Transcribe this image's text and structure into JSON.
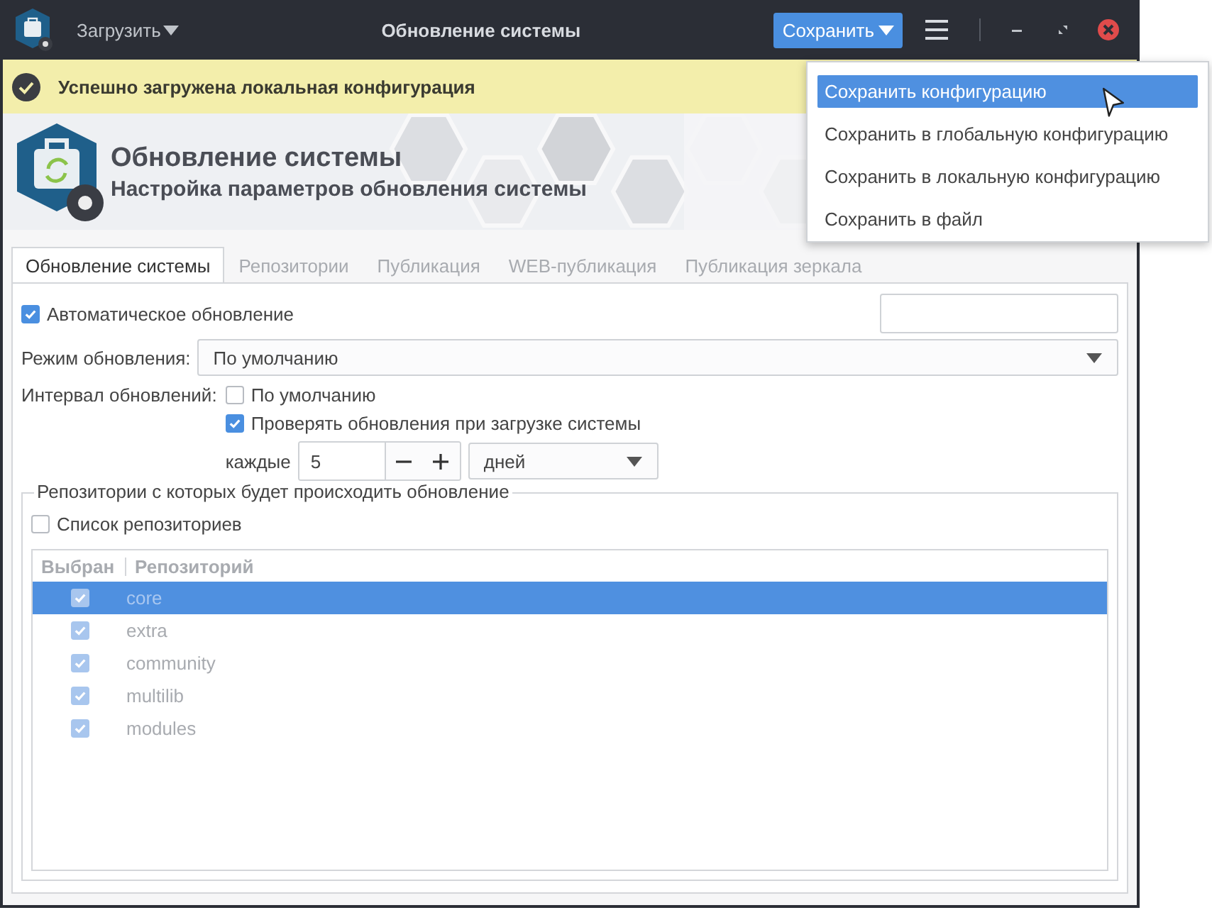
{
  "window": {
    "title": "Обновление системы"
  },
  "titlebar": {
    "load_button": "Загрузить",
    "save_button": "Сохранить"
  },
  "save_menu": {
    "items": [
      {
        "label": "Сохранить конфигурацию",
        "selected": true
      },
      {
        "label": "Сохранить в глобальную конфигурацию",
        "selected": false
      },
      {
        "label": "Сохранить в локальную конфигурацию",
        "selected": false
      },
      {
        "label": "Сохранить в файл",
        "selected": false
      }
    ]
  },
  "notification": {
    "text": "Успешно загружена локальная конфигурация"
  },
  "header": {
    "title": "Обновление системы",
    "subtitle": "Настройка параметров обновления системы"
  },
  "tabs": [
    {
      "label": "Обновление системы",
      "selected": true
    },
    {
      "label": "Репозитории",
      "selected": false
    },
    {
      "label": "Публикация",
      "selected": false
    },
    {
      "label": "WEB-публикация",
      "selected": false
    },
    {
      "label": "Публикация зеркала",
      "selected": false
    }
  ],
  "auto_update": {
    "label": "Автоматическое обновление",
    "checked": true
  },
  "update_mode": {
    "label": "Режим обновления:",
    "value": "По умолчанию"
  },
  "interval": {
    "label": "Интервал обновлений:",
    "options": [
      {
        "label": "По умолчанию",
        "checked": false
      },
      {
        "label": "Проверять обновления при загрузке системы",
        "checked": true
      }
    ],
    "every_label": "каждые",
    "count": "5",
    "unit": "дней"
  },
  "repositories": {
    "legend": "Репозитории с которых будет происходить обновление",
    "list_toggle": {
      "label": "Список репозиториев",
      "checked": false
    },
    "disabled": true,
    "columns": [
      "Выбран",
      "Репозиторий"
    ],
    "rows": [
      {
        "name": "core",
        "checked": true,
        "selected": true
      },
      {
        "name": "extra",
        "checked": true,
        "selected": false
      },
      {
        "name": "community",
        "checked": true,
        "selected": false
      },
      {
        "name": "multilib",
        "checked": true,
        "selected": false
      },
      {
        "name": "modules",
        "checked": true,
        "selected": false
      }
    ]
  }
}
